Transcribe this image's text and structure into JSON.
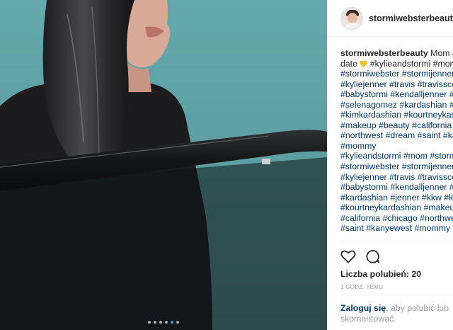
{
  "post": {
    "username": "stormiwebsterbeauty",
    "caption": {
      "username": "stormiwebsterbeauty",
      "first_line_rest": " Mom &",
      "lines": [
        "#stormiwebster #stormijenner",
        "#kyliejenner #travis #travisscott",
        "#babystormi #kendalljenner #s",
        "#selenagomez #kardashian #je",
        "#kimkardashian #kourtneykard",
        "#makeup #beauty #california #",
        "#northwest #dream #saint #ka",
        "#mommy",
        "#kylieandstormi #mom #storm",
        "#stormiwebster #stormijenner",
        "#kyliejenner #travis #travisscott",
        "#babystormi #kendalljenner #s",
        "#kardashian #jenner #kkw #kim",
        "#kourtneykardashian #makeup",
        "#california #chicago #northwes",
        "#saint #kanyewest #mommy"
      ],
      "second_line_prefix": "date ",
      "second_line_tags": " #kylieandstormi #mom"
    },
    "emoji": "yellow-heart",
    "likes_text": "Liczba polubień: 20",
    "time_text": "1 GODZ. TEMU",
    "login_link": "Zaloguj się",
    "login_rest": ", aby polubić lub skomentować.",
    "carousel": {
      "count": 6,
      "active_index": 4
    }
  },
  "colors": {
    "link": "#003569",
    "text": "#262626",
    "muted": "#999999",
    "carousel_active": "#3897f0",
    "emoji_heart": "#f2c51e"
  },
  "icons": [
    "heart-icon",
    "comment-icon"
  ]
}
